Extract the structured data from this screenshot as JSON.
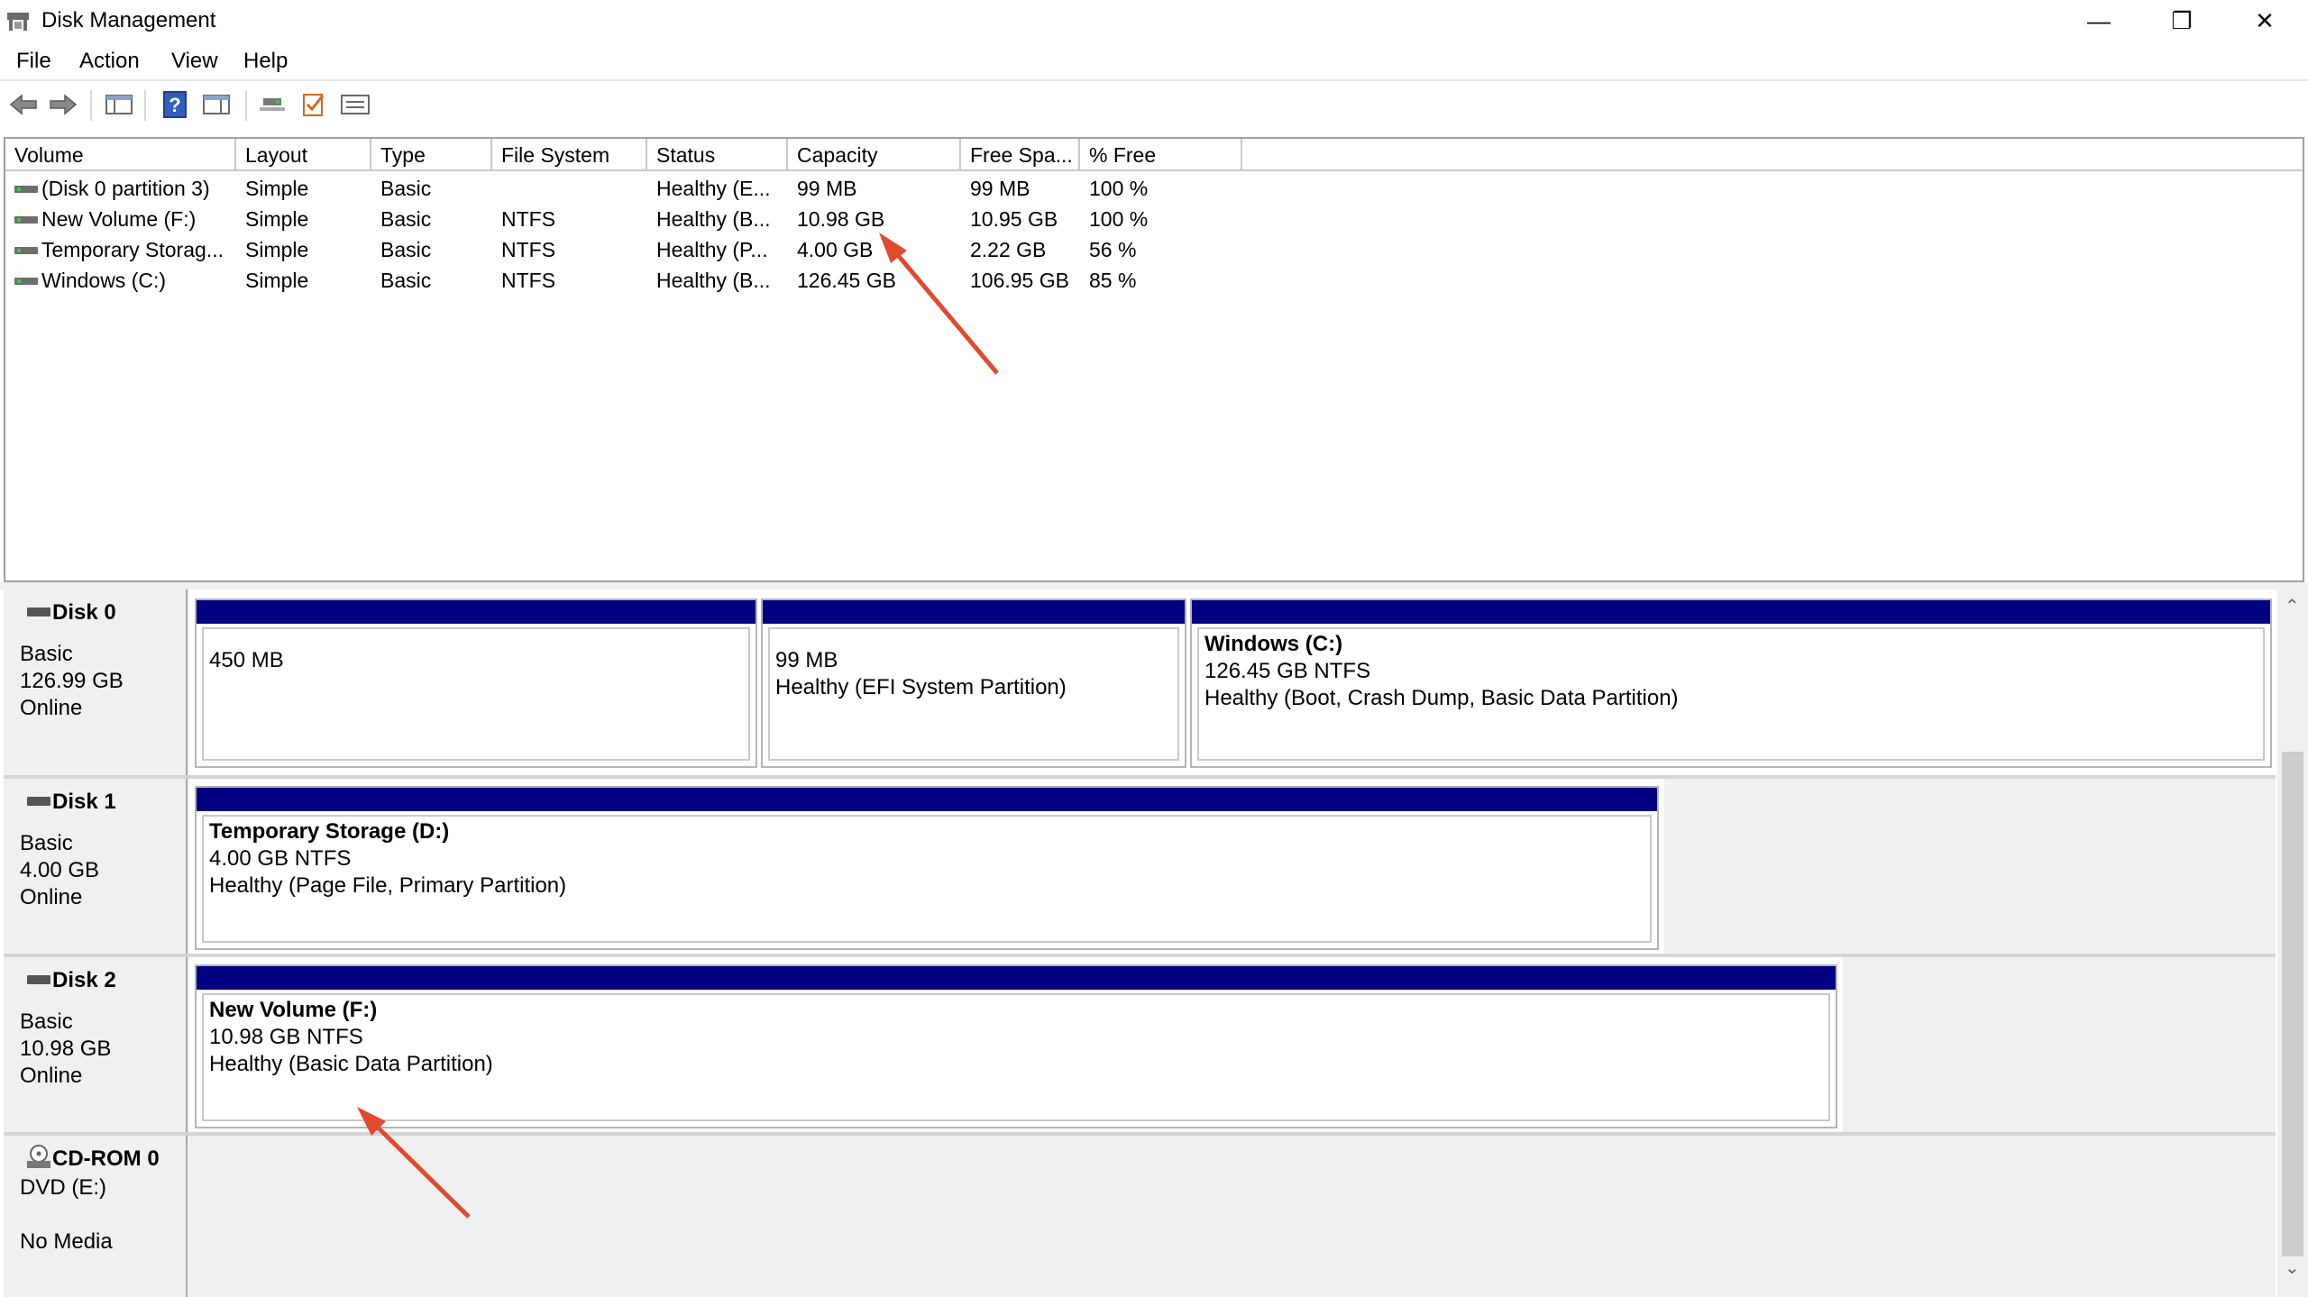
{
  "window": {
    "title": "Disk Management",
    "controls": {
      "minimize": "—",
      "restore": "❐",
      "close": "✕"
    }
  },
  "menu": {
    "file": "File",
    "action": "Action",
    "view": "View",
    "help": "Help"
  },
  "toolbar": {
    "icons": [
      "back-arrow-icon",
      "forward-arrow-icon",
      "console-tree-icon",
      "help-icon",
      "show-action-pane-icon",
      "connect-icon",
      "checklist-icon",
      "properties-icon"
    ],
    "help_glyph": "?"
  },
  "volume_list": {
    "columns": [
      "Volume",
      "Layout",
      "Type",
      "File System",
      "Status",
      "Capacity",
      "Free Spa...",
      "% Free"
    ],
    "rows": [
      {
        "volume": "(Disk 0 partition 3)",
        "layout": "Simple",
        "type": "Basic",
        "fs": "",
        "status": "Healthy (E...",
        "capacity": "99 MB",
        "free": "99 MB",
        "pct": "100 %"
      },
      {
        "volume": "New Volume (F:)",
        "layout": "Simple",
        "type": "Basic",
        "fs": "NTFS",
        "status": "Healthy (B...",
        "capacity": "10.98 GB",
        "free": "10.95 GB",
        "pct": "100 %"
      },
      {
        "volume": "Temporary Storag...",
        "layout": "Simple",
        "type": "Basic",
        "fs": "NTFS",
        "status": "Healthy (P...",
        "capacity": "4.00 GB",
        "free": "2.22 GB",
        "pct": "56 %"
      },
      {
        "volume": "Windows (C:)",
        "layout": "Simple",
        "type": "Basic",
        "fs": "NTFS",
        "status": "Healthy (B...",
        "capacity": "126.45 GB",
        "free": "106.95 GB",
        "pct": "85 %"
      }
    ]
  },
  "disks": [
    {
      "name": "Disk 0",
      "type": "Basic",
      "size": "126.99 GB",
      "state": "Online",
      "partitions": [
        {
          "title": "",
          "line1": "450 MB",
          "line2": ""
        },
        {
          "title": "",
          "line1": "99 MB",
          "line2": "Healthy (EFI System Partition)"
        },
        {
          "title": "Windows  (C:)",
          "line1": "126.45 GB NTFS",
          "line2": "Healthy (Boot, Crash Dump, Basic Data Partition)"
        }
      ]
    },
    {
      "name": "Disk 1",
      "type": "Basic",
      "size": "4.00 GB",
      "state": "Online",
      "partitions": [
        {
          "title": "Temporary Storage  (D:)",
          "line1": "4.00 GB NTFS",
          "line2": "Healthy (Page File, Primary Partition)"
        }
      ]
    },
    {
      "name": "Disk 2",
      "type": "Basic",
      "size": "10.98 GB",
      "state": "Online",
      "partitions": [
        {
          "title": "New Volume  (F:)",
          "line1": "10.98 GB NTFS",
          "line2": "Healthy (Basic Data Partition)"
        }
      ]
    },
    {
      "name": "CD-ROM 0",
      "type": "DVD (E:)",
      "size": "",
      "state": "No Media"
    }
  ],
  "colors": {
    "partition_bar": "#000080",
    "annotation_arrow": "#e04a2f",
    "drive_led": "#35d435"
  },
  "scrollbar": {
    "up": "⌃",
    "down": "⌄"
  }
}
